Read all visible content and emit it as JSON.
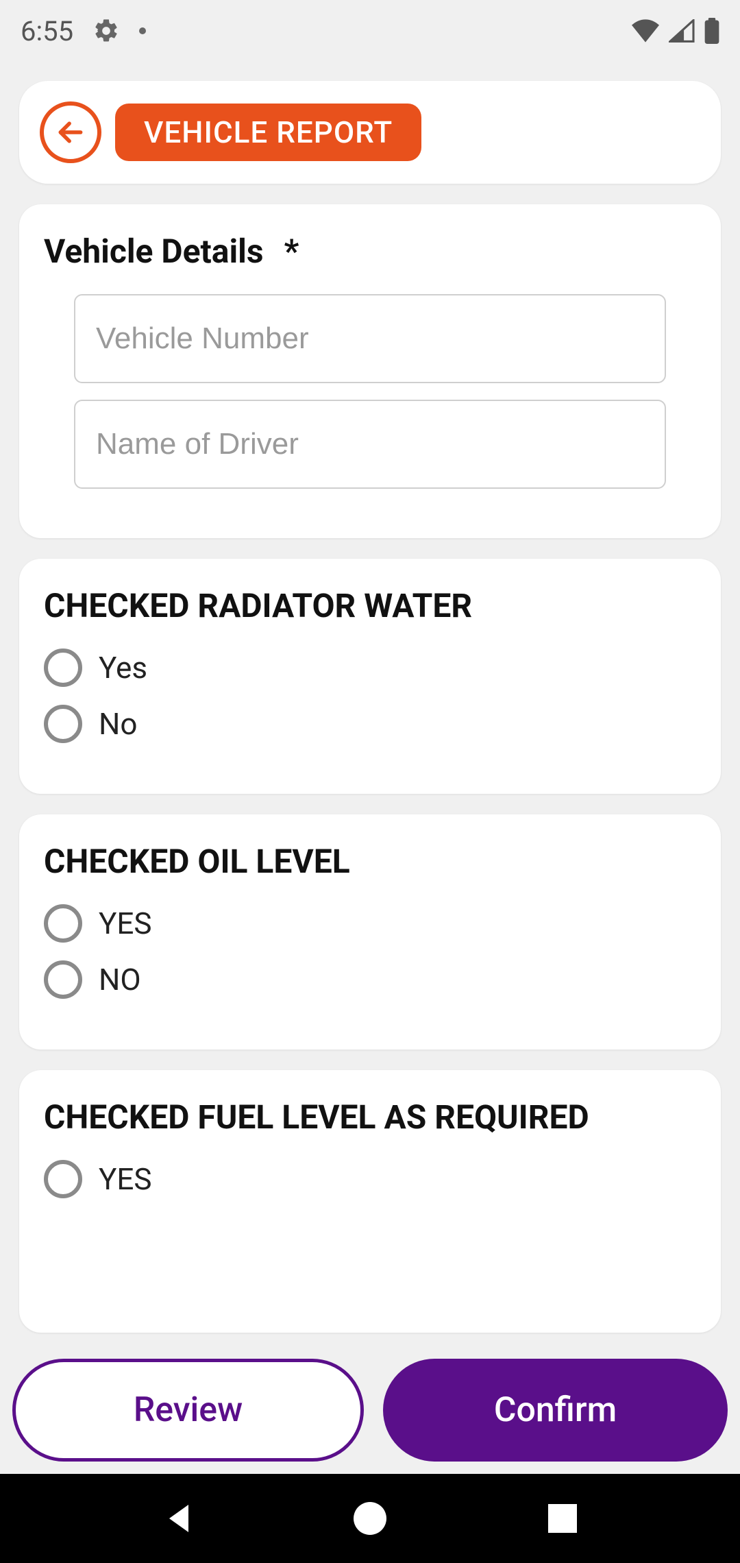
{
  "status": {
    "time": "6:55"
  },
  "header": {
    "title": "VEHICLE REPORT"
  },
  "vehicle_details": {
    "title": "Vehicle Details",
    "required_mark": "*",
    "vehicle_number_placeholder": "Vehicle Number",
    "driver_name_placeholder": "Name of Driver"
  },
  "sections": {
    "radiator": {
      "title": "CHECKED RADIATOR WATER",
      "yes": "Yes",
      "no": "No"
    },
    "oil": {
      "title": "CHECKED OIL LEVEL",
      "yes": "YES",
      "no": "NO"
    },
    "fuel": {
      "title": "CHECKED FUEL LEVEL AS REQUIRED",
      "yes": "YES"
    }
  },
  "footer": {
    "review": "Review",
    "confirm": "Confirm"
  }
}
